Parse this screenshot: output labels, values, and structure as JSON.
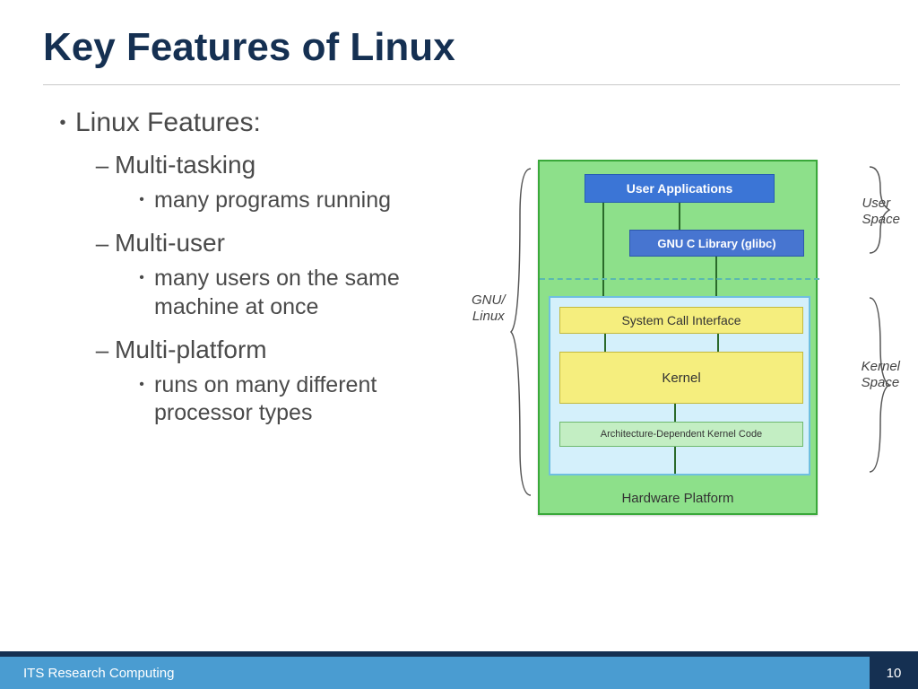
{
  "title": "Key Features of Linux",
  "bullets": {
    "heading": "Linux Features:",
    "items": [
      {
        "label": "Multi-tasking",
        "detail": "many programs running"
      },
      {
        "label": "Multi-user",
        "detail": "many users on the same machine at once"
      },
      {
        "label": "Multi-platform",
        "detail": "runs on many different processor types"
      }
    ]
  },
  "diagram": {
    "user_applications": "User Applications",
    "glibc": "GNU C Library (glibc)",
    "sci": "System Call Interface",
    "kernel": "Kernel",
    "arch": "Architecture-Dependent Kernel Code",
    "hw": "Hardware Platform",
    "left_label_1": "GNU/",
    "left_label_2": "Linux",
    "user_space_1": "User",
    "user_space_2": "Space",
    "kernel_space_1": "Kernel",
    "kernel_space_2": "Space"
  },
  "footer": {
    "label": "ITS Research Computing",
    "page": "10"
  }
}
